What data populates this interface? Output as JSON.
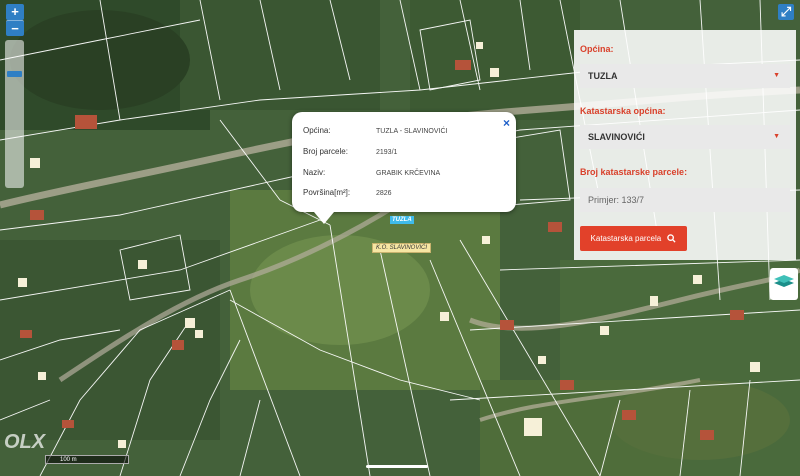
{
  "map": {
    "zoom_in_label": "+",
    "zoom_out_label": "−",
    "expand_label": "⤢",
    "scale_label": "100 m",
    "watermark": "OLX",
    "layers_icon": "layers-icon"
  },
  "popup": {
    "close_label": "×",
    "rows": [
      {
        "label": "Općina:",
        "value": "TUZLA - SLAVINOVIĆI"
      },
      {
        "label": "Broj parcele:",
        "value": "2193/1"
      },
      {
        "label": "Naziv:",
        "value": "GRABIK KRČEVINA"
      },
      {
        "label": "Površina[m²]:",
        "value": "2826"
      }
    ]
  },
  "labels": {
    "tuzla": "TUZLA",
    "ko": "K.O. SLAVINOVIĆI"
  },
  "panel": {
    "opcina_label": "Općina:",
    "opcina_value": "TUZLA",
    "ko_label": "Katastarska općina:",
    "ko_value": "SLAVINOVIĆI",
    "parcel_label": "Broj katastarske parcele:",
    "parcel_placeholder": "Primjer: 133/7",
    "search_label": "Katastarska parcela",
    "accent": "#e2412a"
  }
}
